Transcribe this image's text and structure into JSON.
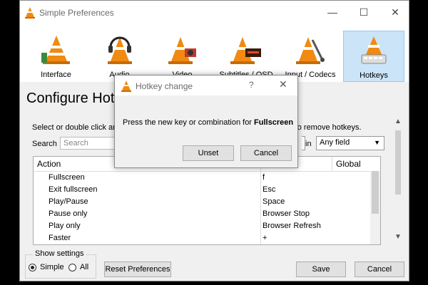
{
  "window": {
    "title": "Simple Preferences",
    "controls": {
      "minimize": "—",
      "maximize": "☐",
      "close": "✕"
    }
  },
  "toolbar": {
    "items": [
      {
        "label": "Interface",
        "icon": "interface-cone-icon",
        "active": false
      },
      {
        "label": "Audio",
        "icon": "audio-cone-icon",
        "active": false
      },
      {
        "label": "Video",
        "icon": "video-cone-icon",
        "active": false
      },
      {
        "label": "Subtitles / OSD",
        "icon": "subtitles-cone-icon",
        "active": false
      },
      {
        "label": "Input / Codecs",
        "icon": "input-codecs-cone-icon",
        "active": false
      },
      {
        "label": "Hotkeys",
        "icon": "hotkeys-cone-icon",
        "active": true
      }
    ]
  },
  "main": {
    "heading": "Configure Hotk",
    "description_left": "Select or double click an",
    "description_right": "ey to remove hotkeys.",
    "search_label": "Search",
    "search_placeholder": "Search",
    "in_label": "in",
    "field_select": "Any field",
    "table": {
      "headers": [
        "Action",
        "Global"
      ],
      "rows": [
        {
          "action": "Fullscreen",
          "hotkey": "f"
        },
        {
          "action": "Exit fullscreen",
          "hotkey": "Esc"
        },
        {
          "action": "Play/Pause",
          "hotkey": "Space"
        },
        {
          "action": "Pause only",
          "hotkey": "Browser Stop"
        },
        {
          "action": "Play only",
          "hotkey": "Browser Refresh"
        },
        {
          "action": "Faster",
          "hotkey": "+"
        }
      ]
    }
  },
  "footer": {
    "show_settings_label": "Show settings",
    "simple_label": "Simple",
    "all_label": "All",
    "selected": "Simple",
    "reset_label": "Reset Preferences",
    "save_label": "Save",
    "cancel_label": "Cancel"
  },
  "dialog": {
    "title": "Hotkey change",
    "help": "?",
    "close": "✕",
    "message_prefix": "Press the new key or combination for ",
    "message_action": "Fullscreen",
    "unset_label": "Unset",
    "cancel_label": "Cancel"
  },
  "colors": {
    "cone_orange": "#f08a10",
    "active_tab_bg": "#cce4f7",
    "active_tab_border": "#99c9ef"
  }
}
